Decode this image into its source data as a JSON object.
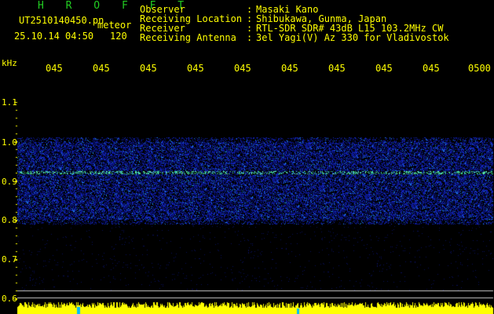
{
  "header": {
    "app_name": "H R O F F T",
    "filename": "UT2510140450.pn",
    "mode": "meteor",
    "datetime": "25.10.14 04:50",
    "count": "120",
    "labels": [
      "Observer",
      "Receiving Location",
      "Receiver",
      "Receiving Antenna"
    ],
    "separators": [
      ":",
      ":",
      ":",
      ":"
    ],
    "values": [
      "Masaki Kano",
      "Shibukawa, Gunma, Japan",
      "RTL-SDR SDR# 43dB L15 103.2MHz CW",
      "3el Yagi(V) Az 330 for Vladivostok"
    ]
  },
  "chart_data": {
    "type": "heatmap",
    "ylabel": "kHz",
    "y_ticks": [
      "1.1",
      "1.0",
      "0.9",
      "0.8",
      "0.7",
      "0.6"
    ],
    "x_ticks": [
      "045",
      "045",
      "045",
      "045",
      "045",
      "045",
      "045",
      "045",
      "045",
      "0500"
    ],
    "ylim": [
      0.58,
      1.15
    ],
    "band": [
      0.79,
      1.01
    ],
    "signal_line": 0.92,
    "colors": {
      "background": "#000000",
      "noise": "#2233cc",
      "signal": "#33ee88",
      "axis_text": "#ffff00"
    }
  }
}
